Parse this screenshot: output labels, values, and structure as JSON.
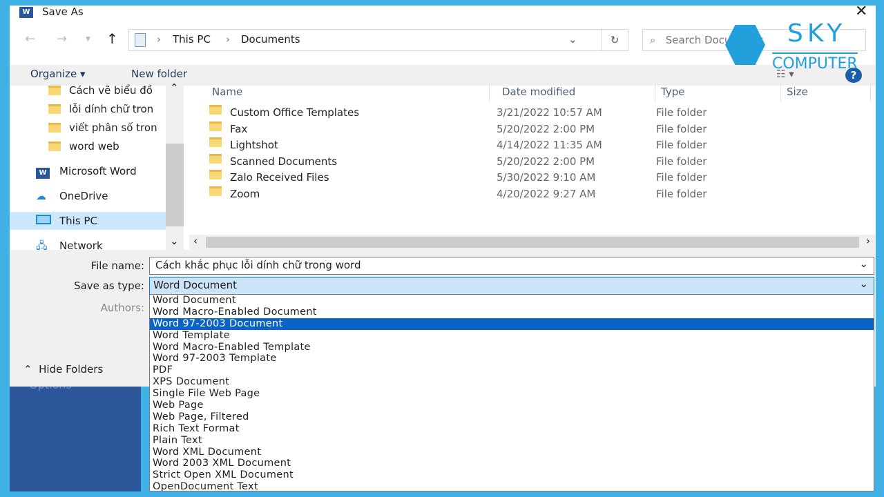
{
  "window": {
    "title": "Save As",
    "app_icon": "word-icon"
  },
  "nav": {
    "path": [
      "This PC",
      "Documents"
    ],
    "search_placeholder": "Search Documents"
  },
  "toolbar": {
    "organize": "Organize",
    "new_folder": "New folder"
  },
  "sidebar": {
    "items": [
      {
        "label": "Cách vẽ biểu đồ",
        "icon": "folder-icon"
      },
      {
        "label": "lỗi dính chữ tron",
        "icon": "folder-icon"
      },
      {
        "label": "viết phân số tron",
        "icon": "folder-icon"
      },
      {
        "label": "word web",
        "icon": "folder-icon"
      },
      {
        "label": "Microsoft Word",
        "icon": "word-icon"
      },
      {
        "label": "OneDrive",
        "icon": "cloud-icon"
      },
      {
        "label": "This PC",
        "icon": "pc-icon",
        "selected": true
      },
      {
        "label": "Network",
        "icon": "network-icon"
      }
    ]
  },
  "columns": {
    "name": "Name",
    "date": "Date modified",
    "type": "Type",
    "size": "Size"
  },
  "files": [
    {
      "name": "Custom Office Templates",
      "date": "3/21/2022 10:57 AM",
      "type": "File folder"
    },
    {
      "name": "Fax",
      "date": "5/20/2022 2:00 PM",
      "type": "File folder"
    },
    {
      "name": "Lightshot",
      "date": "4/14/2022 11:35 AM",
      "type": "File folder"
    },
    {
      "name": "Scanned Documents",
      "date": "5/20/2022 2:00 PM",
      "type": "File folder"
    },
    {
      "name": "Zalo Received Files",
      "date": "5/30/2022 9:10 AM",
      "type": "File folder"
    },
    {
      "name": "Zoom",
      "date": "4/20/2022 9:27 AM",
      "type": "File folder"
    }
  ],
  "form": {
    "file_name_label": "File name:",
    "file_name": "Cách khắc phục lỗi dính chữ trong word",
    "type_label": "Save as type:",
    "type_value": "Word Document",
    "authors_label": "Authors:",
    "hide_folders": "Hide Folders"
  },
  "type_options": [
    "Word Document",
    "Word Macro-Enabled Document",
    "Word 97-2003 Document",
    "Word Template",
    "Word Macro-Enabled Template",
    "Word 97-2003 Template",
    "PDF",
    "XPS Document",
    "Single File Web Page",
    "Web Page",
    "Web Page, Filtered",
    "Rich Text Format",
    "Plain Text",
    "Word XML Document",
    "Word 2003 XML Document",
    "Strict Open XML Document",
    "OpenDocument Text"
  ],
  "highlighted_option": "Word 97-2003 Document",
  "backstage": {
    "options": "Options"
  },
  "watermark": {
    "line1": "SKY",
    "line2": "COMPUTER"
  },
  "colors": {
    "frame": "#3fb1e5",
    "highlight": "#0a64c8",
    "backstage": "#2b579a"
  }
}
